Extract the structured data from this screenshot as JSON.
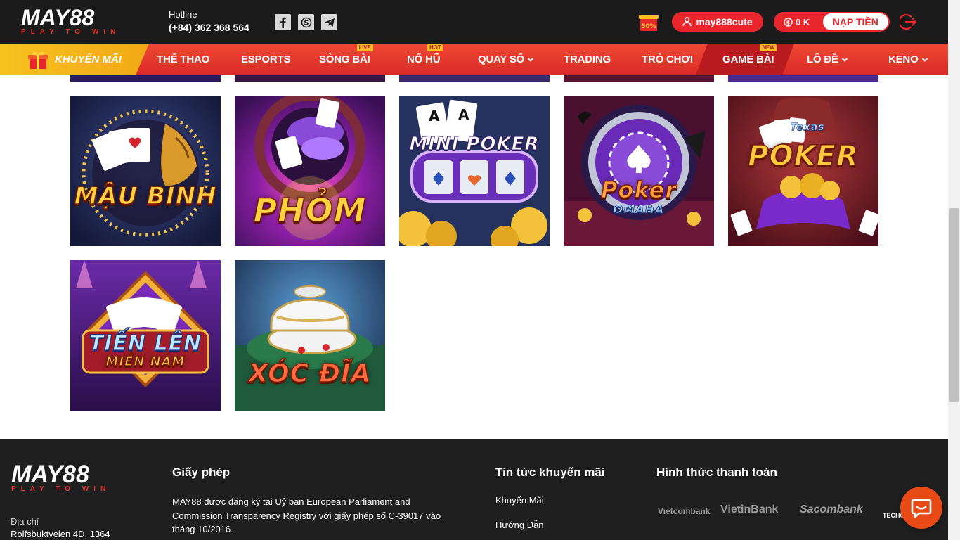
{
  "header": {
    "logo_text": "MAY88",
    "logo_tagline": "PLAY TO WIN",
    "hotline_label": "Hotline",
    "hotline_number": "(+84) 362 368 564",
    "username": "may888cute",
    "balance": "0 K",
    "deposit_label": "NẠP TIỀN"
  },
  "nav": {
    "promo_label": "KHUYẾN MÃI",
    "items": [
      {
        "label": "THỂ THAO",
        "tag": ""
      },
      {
        "label": "ESPORTS",
        "tag": ""
      },
      {
        "label": "SÒNG BÀI",
        "tag": "LIVE"
      },
      {
        "label": "NỔ HŨ",
        "tag": "HOT"
      },
      {
        "label": "QUAY SỐ",
        "tag": ""
      },
      {
        "label": "TRADING",
        "tag": ""
      },
      {
        "label": "TRÒ CHƠI",
        "tag": ""
      },
      {
        "label": "GAME BÀI",
        "tag": "NEW"
      },
      {
        "label": "LÔ ĐỀ",
        "tag": ""
      },
      {
        "label": "KENO",
        "tag": ""
      }
    ]
  },
  "games": [
    {
      "title": "MẬU BINH"
    },
    {
      "title": "PHỎM"
    },
    {
      "title": "MINI POKER"
    },
    {
      "title": "Poker",
      "subtitle": "OMAHA"
    },
    {
      "title": "POKER",
      "subtitle": "Texas"
    },
    {
      "title": "TIẾN LÊN",
      "subtitle": "MIỀN NAM"
    },
    {
      "title": "XÓC ĐĨA"
    }
  ],
  "footer": {
    "logo_text": "MAY88",
    "logo_tagline": "PLAY TO WIN",
    "address_label": "Địa chỉ",
    "address": "Rolfsbuktveien 4D, 1364",
    "license_heading": "Giấy phép",
    "license_text": "MAY88 được đăng ký tại Uỷ ban European Parliament and Commission Transparency Registry với giấy phép số C-39017 vào tháng 10/2016.",
    "news_heading": "Tin tức khuyến mãi",
    "news_links": [
      "Khuyến Mãi",
      "Hướng Dẫn"
    ],
    "payment_heading": "Hình thức thanh toán",
    "banks": [
      "Vietcombank",
      "VietinBank",
      "Sacombank",
      "TECHCO"
    ]
  },
  "colors": {
    "brand_red": "#e8262b",
    "promo_yellow": "#f7c21f",
    "header_bg": "#1b1b1b",
    "footer_bg": "#1f1f1f"
  },
  "icons": [
    "facebook-icon",
    "skype-icon",
    "telegram-icon",
    "user-icon",
    "coin-icon",
    "logout-icon",
    "gift-icon",
    "chevron-down-icon",
    "chat-icon"
  ]
}
